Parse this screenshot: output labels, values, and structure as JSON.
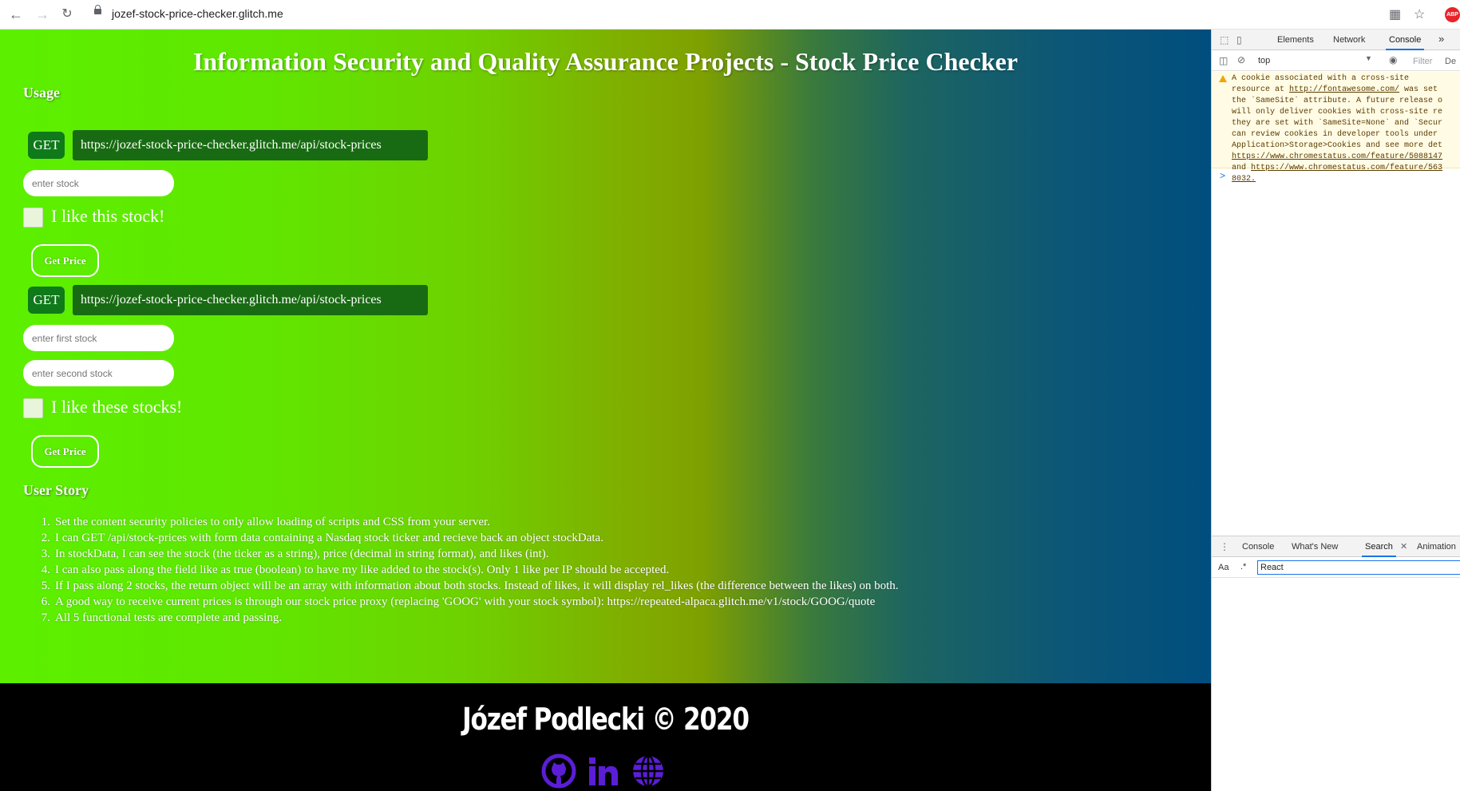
{
  "browser": {
    "url": "jozef-stock-price-checker.glitch.me",
    "back_icon": "arrow-left-icon",
    "forward_icon": "arrow-right-icon",
    "reload_icon": "reload-icon",
    "abp_label": "ABP"
  },
  "page": {
    "title": "Information Security and Quality Assurance Projects - Stock Price Checker",
    "usage_heading": "Usage",
    "form1": {
      "method": "GET",
      "endpoint": "https://jozef-stock-price-checker.glitch.me/api/stock-prices",
      "stock_placeholder": "enter stock",
      "like_label": "I like this stock!",
      "button": "Get Price"
    },
    "form2": {
      "method": "GET",
      "endpoint": "https://jozef-stock-price-checker.glitch.me/api/stock-prices",
      "first_placeholder": "enter first stock",
      "second_placeholder": "enter second stock",
      "like_label": "I like these stocks!",
      "button": "Get Price"
    },
    "user_story_heading": "User Story",
    "stories": [
      {
        "num": "1.",
        "text": "Set the content security policies to only allow loading of scripts and CSS from your server."
      },
      {
        "num": "2.",
        "text": "I can GET /api/stock-prices with form data containing a Nasdaq stock ticker and recieve back an object stockData."
      },
      {
        "num": "3.",
        "text": "In stockData, I can see the stock (the ticker as a string), price (decimal in string format), and likes (int)."
      },
      {
        "num": "4.",
        "text": "I can also pass along the field like as true (boolean) to have my like added to the stock(s). Only 1 like per IP should be accepted."
      },
      {
        "num": "5.",
        "text": "If I pass along 2 stocks, the return object will be an array with information about both stocks. Instead of likes, it will display rel_likes (the difference between the likes) on both."
      },
      {
        "num": "6.",
        "text": "A good way to receive current prices is through our stock price proxy (replacing 'GOOG' with your stock symbol): https://repeated-alpaca.glitch.me/v1/stock/GOOG/quote"
      },
      {
        "num": "7.",
        "text": "All 5 functional tests are complete and passing."
      }
    ]
  },
  "footer": {
    "name": "Józef Podlecki © 2020",
    "icons": [
      "github-icon",
      "linkedin-icon",
      "globe-icon"
    ],
    "icon_color": "#5b1ed6"
  },
  "devtools": {
    "tabs": [
      "Elements",
      "Network",
      "Console"
    ],
    "active_tab": "Console",
    "more": "»",
    "context": "top",
    "filter_placeholder": "Filter",
    "filter_right": "De",
    "warning_lines": [
      "A cookie associated with a cross-site",
      "resource at ",
      "the `SameSite` attribute. A future release o",
      "will only deliver cookies with cross-site re",
      "they are set with `SameSite=None` and `Secur",
      "can review cookies in developer tools under",
      "Application>Storage>Cookies and see more det",
      "",
      "and ",
      "8032."
    ],
    "warning_link1": "http://fontawesome.com/",
    "warning_after_link1": " was set",
    "warning_link2": "https://www.chromestatus.com/feature/5088147",
    "warning_link3": "https://www.chromestatus.com/feature/563",
    "prompt": ">",
    "drawer_tabs": [
      "Console",
      "What's New",
      "Search",
      "Animation"
    ],
    "drawer_active": "Search",
    "search_case": "Aa",
    "search_regex": ".*",
    "search_value": "React"
  }
}
